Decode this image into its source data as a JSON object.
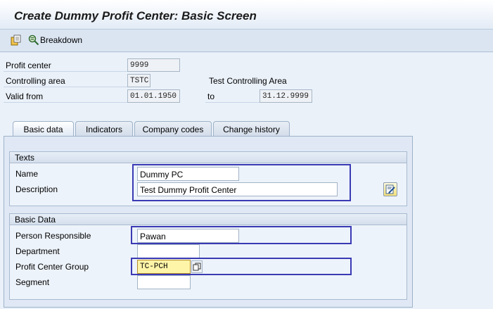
{
  "title": "Create Dummy Profit Center: Basic Screen",
  "toolbar": {
    "breakdown_label": "Breakdown",
    "icons": [
      "document-icon",
      "breakdown-icon"
    ]
  },
  "header": {
    "profit_center": {
      "label": "Profit center",
      "value": "9999"
    },
    "controlling_area": {
      "label": "Controlling area",
      "value": "TSTC",
      "description": "Test Controlling Area"
    },
    "valid_from": {
      "label": "Valid from",
      "value": "01.01.1950",
      "to_label": "to",
      "to_value": "31.12.9999"
    }
  },
  "tabs": [
    {
      "label": "Basic data",
      "active": true
    },
    {
      "label": "Indicators",
      "active": false
    },
    {
      "label": "Company codes",
      "active": false
    },
    {
      "label": "Change history",
      "active": false
    }
  ],
  "texts_group": {
    "title": "Texts",
    "name": {
      "label": "Name",
      "value": "Dummy PC"
    },
    "description": {
      "label": "Description",
      "value": "Test Dummy Profit Center"
    }
  },
  "basic_data_group": {
    "title": "Basic Data",
    "person_responsible": {
      "label": "Person Responsible",
      "value": "Pawan"
    },
    "department": {
      "label": "Department",
      "value": ""
    },
    "profit_center_group": {
      "label": "Profit Center Group",
      "value": "TC-PCH"
    },
    "segment": {
      "label": "Segment",
      "value": ""
    }
  },
  "colors": {
    "background": "#dfe9f5",
    "highlight_border": "#3a3ab4",
    "focused_field": "#fff5a8"
  }
}
